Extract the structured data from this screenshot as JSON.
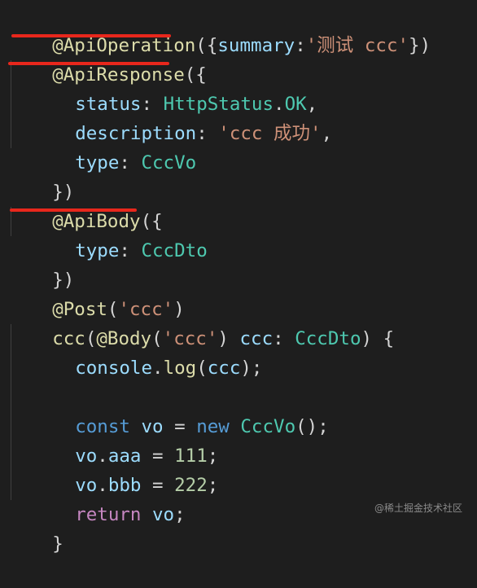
{
  "code": {
    "l1": {
      "at": "@",
      "dec": "ApiOperation",
      "open": "({",
      "key": "summary",
      "colon": ":",
      "str": "'测试 ccc'",
      "close": "})"
    },
    "l2": {
      "at": "@",
      "dec": "ApiResponse",
      "open": "({"
    },
    "l3": {
      "prop": "status",
      "colon": ": ",
      "type": "HttpStatus",
      "dot": ".",
      "member": "OK",
      "comma": ","
    },
    "l4": {
      "prop": "description",
      "colon": ": ",
      "str": "'ccc 成功'",
      "comma": ","
    },
    "l5": {
      "prop": "type",
      "colon": ": ",
      "type": "CccVo"
    },
    "l6": {
      "close": "})"
    },
    "l7": {
      "at": "@",
      "dec": "ApiBody",
      "open": "({"
    },
    "l8": {
      "prop": "type",
      "colon": ": ",
      "type": "CccDto"
    },
    "l9": {
      "close": "})"
    },
    "l10": {
      "at": "@",
      "dec": "Post",
      "open": "(",
      "str": "'ccc'",
      "close": ")"
    },
    "l11": {
      "fn": "ccc",
      "open": "(",
      "at": "@",
      "dec": "Body",
      "open2": "(",
      "str": "'ccc'",
      "close2": ")",
      "param": " ccc",
      "colon": ": ",
      "type": "CccDto",
      "close": ")",
      "brace": " {"
    },
    "l12": {
      "obj": "console",
      "dot": ".",
      "fn": "log",
      "open": "(",
      "arg": "ccc",
      "close": ");"
    },
    "l14": {
      "kw": "const",
      "var": " vo",
      "eq": " = ",
      "kw2": "new",
      "type": " CccVo",
      "call": "();"
    },
    "l15": {
      "obj": "vo",
      "dot": ".",
      "member": "aaa",
      "eq": " = ",
      "num": "111",
      "semi": ";"
    },
    "l16": {
      "obj": "vo",
      "dot": ".",
      "member": "bbb",
      "eq": " = ",
      "num": "222",
      "semi": ";"
    },
    "l17": {
      "kw": "return",
      "var": " vo",
      "semi": ";"
    },
    "l18": {
      "close": "}"
    }
  },
  "watermark": "@稀土掘金技术社区",
  "colors": {
    "background": "#1e1e1e",
    "decorator": "#dcdcaa",
    "string": "#ce9178",
    "property": "#9cdcfe",
    "type": "#4ec9b0",
    "keyword": "#569cd6",
    "control": "#c586c0",
    "number": "#b5cea8",
    "annotation_underline": "#e8271c"
  }
}
